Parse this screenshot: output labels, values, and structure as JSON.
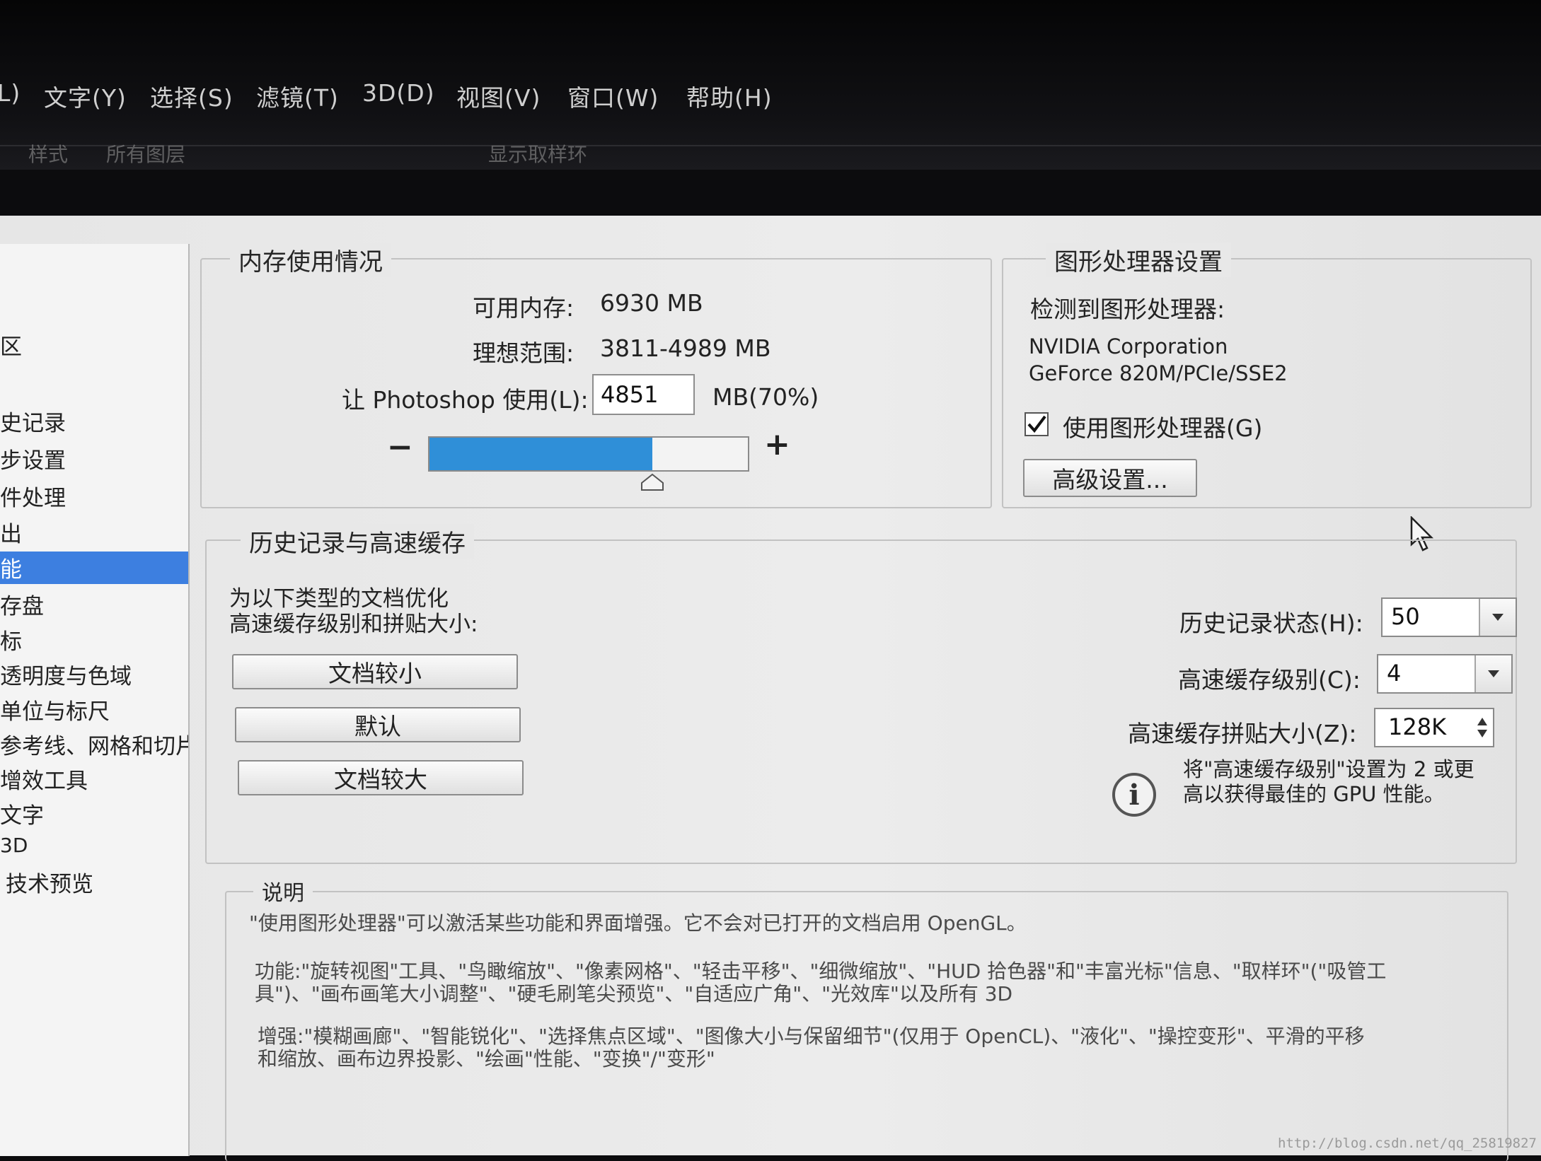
{
  "menubar": {
    "items": [
      "文字(Y)",
      "选择(S)",
      "滤镜(T)",
      "3D(D)",
      "视图(V)",
      "窗口(W)",
      "帮助(H)"
    ],
    "partial_left": "L)"
  },
  "subbar": {
    "fragments": [
      "样式",
      "所有图层",
      "显示取样环"
    ]
  },
  "sidebar": {
    "items": [
      "区",
      "史记录",
      "步设置",
      "件处理",
      "出",
      "能",
      "存盘",
      "标",
      "透明度与色域",
      "单位与标尺",
      "参考线、网格和切片",
      "增效工具",
      "文字",
      "3D",
      "技术预览"
    ],
    "selected": "能"
  },
  "memory": {
    "title": "内存使用情况",
    "available_label": "可用内存:",
    "available_value": "6930 MB",
    "ideal_label": "理想范围:",
    "ideal_value": "3811-4989 MB",
    "let_label": "让 Photoshop 使用(L):",
    "let_value": "4851",
    "let_unit": "MB(70%)",
    "usage_fraction": 0.7,
    "minus": "−",
    "plus": "+"
  },
  "gpu": {
    "title": "图形处理器设置",
    "detected_label": "检测到图形处理器:",
    "vendor": "NVIDIA Corporation",
    "model": "GeForce 820M/PCIe/SSE2",
    "use_gpu_label": "使用图形处理器(G)",
    "use_gpu_checked": true,
    "advanced_button": "高级设置..."
  },
  "history": {
    "title": "历史记录与高速缓存",
    "optimize_line1": "为以下类型的文档优化",
    "optimize_line2": "高速缓存级别和拼贴大小:",
    "btn_small": "文档较小",
    "btn_default": "默认",
    "btn_large": "文档较大",
    "states_label": "历史记录状态(H):",
    "states_value": "50",
    "cache_levels_label": "高速缓存级别(C):",
    "cache_levels_value": "4",
    "tile_size_label": "高速缓存拼贴大小(Z):",
    "tile_size_value": "128K",
    "tip_line1": "将\"高速缓存级别\"设置为 2 或更",
    "tip_line2": "高以获得最佳的 GPU 性能。"
  },
  "description": {
    "title": "说明",
    "p1": "\"使用图形处理器\"可以激活某些功能和界面增强。它不会对已打开的文档启用 OpenGL。",
    "p2a": "功能:\"旋转视图\"工具、\"鸟瞰缩放\"、\"像素网格\"、\"轻击平移\"、\"细微缩放\"、\"HUD 拾色器\"和\"丰富光标\"信息、\"取样环\"(\"吸管工",
    "p2b": "具\")、\"画布画笔大小调整\"、\"硬毛刷笔尖预览\"、\"自适应广角\"、\"光效库\"以及所有 3D",
    "p3a": "增强:\"模糊画廊\"、\"智能锐化\"、\"选择焦点区域\"、\"图像大小与保留细节\"(仅用于 OpenCL)、\"液化\"、\"操控变形\"、平滑的平移",
    "p3b": "和缩放、画布边界投影、\"绘画\"性能、\"变换\"/\"变形\""
  },
  "watermark": "http://blog.csdn.net/qq_25819827"
}
